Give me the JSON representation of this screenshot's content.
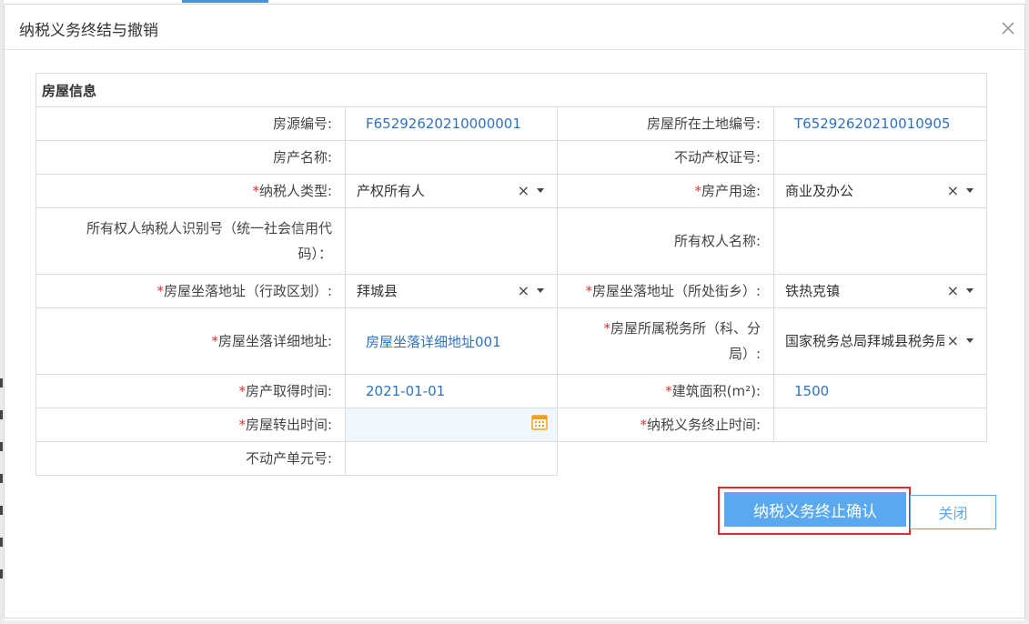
{
  "dialog": {
    "title": "纳税义务终结与撤销",
    "section_title": "房屋信息"
  },
  "fields": {
    "house_source_no": {
      "label": "房源编号:",
      "value": "F65292620210000001"
    },
    "land_no": {
      "label": "房屋所在土地编号:",
      "value": "T65292620210010905"
    },
    "property_name": {
      "label": "房产名称:",
      "value": ""
    },
    "cert_no": {
      "label": "不动产权证号:",
      "value": ""
    },
    "taxpayer_type": {
      "label": "纳税人类型:",
      "required": "*",
      "value": "产权所有人"
    },
    "property_use": {
      "label": "房产用途:",
      "required": "*",
      "value": "商业及办公"
    },
    "owner_taxpayer_id": {
      "label": "所有权人纳税人识别号（统一社会信用代码）：",
      "value": ""
    },
    "owner_name": {
      "label": "所有权人名称:",
      "value": ""
    },
    "address_district": {
      "label": "房屋坐落地址（行政区划）:",
      "required": "*",
      "value": "拜城县"
    },
    "address_street": {
      "label": "房屋坐落地址（所处街乡）:",
      "required": "*",
      "value": "铁热克镇"
    },
    "address_detail": {
      "label": "房屋坐落详细地址:",
      "required": "*",
      "value": "房屋坐落详细地址001"
    },
    "tax_office": {
      "label": "房屋所属税务所（科、分局）:",
      "required": "*",
      "value": "国家税务总局拜城县税务局"
    },
    "acquire_date": {
      "label": "房产取得时间:",
      "required": "*",
      "value": "2021-01-01"
    },
    "building_area": {
      "label": "建筑面积(m²):",
      "required": "*",
      "value": "1500"
    },
    "transfer_date": {
      "label": "房屋转出时间:",
      "required": "*",
      "value": ""
    },
    "tax_end_date": {
      "label": "纳税义务终止时间:",
      "required": "*",
      "value": ""
    },
    "unit_no": {
      "label": "不动产单元号:",
      "value": ""
    }
  },
  "buttons": {
    "confirm": "纳税义务终止确认",
    "close": "关闭"
  },
  "icons": {
    "close": "close-icon",
    "clear": "clear-icon",
    "dropdown": "chevron-down-icon",
    "calendar": "calendar-icon"
  },
  "colors": {
    "primary": "#5aa8ee",
    "link_value": "#2d72c4",
    "required": "#e03030",
    "highlight": "#d9302f"
  }
}
